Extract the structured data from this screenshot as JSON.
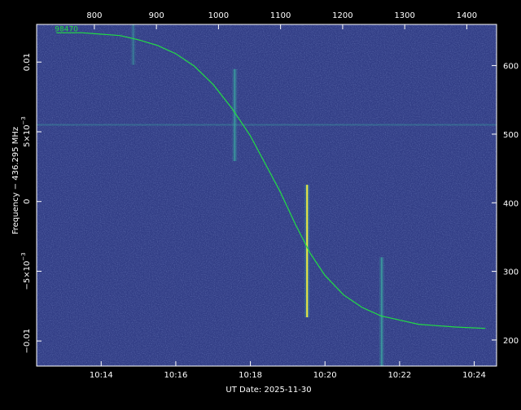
{
  "chart_data": {
    "type": "heatmap",
    "title": "",
    "xlabel": "UT Date: 2025-11-30",
    "ylabel": "Frequency − 436.295 MHz",
    "bottom_axis": {
      "unit": "minutes since 10:00 UT",
      "range": [
        12.27,
        24.6
      ],
      "ticks": [
        {
          "value": 14,
          "label": "10:14"
        },
        {
          "value": 16,
          "label": "10:16"
        },
        {
          "value": 18,
          "label": "10:18"
        },
        {
          "value": 20,
          "label": "10:20"
        },
        {
          "value": 22,
          "label": "10:22"
        },
        {
          "value": 24,
          "label": "10:24"
        }
      ]
    },
    "top_axis": {
      "range": [
        707,
        1448
      ],
      "ticks": [
        {
          "value": 800,
          "label": "800"
        },
        {
          "value": 900,
          "label": "900"
        },
        {
          "value": 1000,
          "label": "1000"
        },
        {
          "value": 1100,
          "label": "1100"
        },
        {
          "value": 1200,
          "label": "1200"
        },
        {
          "value": 1300,
          "label": "1300"
        },
        {
          "value": 1400,
          "label": "1400"
        }
      ]
    },
    "left_axis": {
      "unit": "MHz",
      "range": [
        -0.0118,
        0.0127
      ],
      "ticks": [
        {
          "value": 0.01,
          "label": "0.01",
          "base": "",
          "exp": ""
        },
        {
          "value": 0.005,
          "label": "",
          "base": "5×10",
          "exp": "−3"
        },
        {
          "value": 0,
          "label": "0",
          "base": "",
          "exp": ""
        },
        {
          "value": -0.005,
          "label": "",
          "base": "−5×10",
          "exp": "−3"
        },
        {
          "value": -0.01,
          "label": "−0.01",
          "base": "",
          "exp": ""
        }
      ]
    },
    "right_axis": {
      "range": [
        162,
        660
      ],
      "ticks": [
        {
          "value": 200,
          "label": "200"
        },
        {
          "value": 300,
          "label": "300"
        },
        {
          "value": 400,
          "label": "400"
        },
        {
          "value": 500,
          "label": "500"
        },
        {
          "value": 600,
          "label": "600"
        }
      ]
    },
    "curve": {
      "name": "98470",
      "color": "#22dd44",
      "points": [
        {
          "x": 12.8,
          "y": 0.0121
        },
        {
          "x": 13.5,
          "y": 0.0121
        },
        {
          "x": 14.0,
          "y": 0.012
        },
        {
          "x": 14.5,
          "y": 0.0119
        },
        {
          "x": 15.0,
          "y": 0.0116
        },
        {
          "x": 15.5,
          "y": 0.0112
        },
        {
          "x": 16.0,
          "y": 0.0106
        },
        {
          "x": 16.5,
          "y": 0.0097
        },
        {
          "x": 17.0,
          "y": 0.0084
        },
        {
          "x": 17.5,
          "y": 0.0067
        },
        {
          "x": 18.0,
          "y": 0.0047
        },
        {
          "x": 18.4,
          "y": 0.0027
        },
        {
          "x": 18.8,
          "y": 0.0007
        },
        {
          "x": 19.2,
          "y": -0.0016
        },
        {
          "x": 19.6,
          "y": -0.0037
        },
        {
          "x": 20.0,
          "y": -0.0053
        },
        {
          "x": 20.5,
          "y": -0.0067
        },
        {
          "x": 21.0,
          "y": -0.0076
        },
        {
          "x": 21.5,
          "y": -0.0082
        },
        {
          "x": 22.0,
          "y": -0.0085
        },
        {
          "x": 22.5,
          "y": -0.0088
        },
        {
          "x": 23.0,
          "y": -0.0089
        },
        {
          "x": 23.5,
          "y": -0.009
        },
        {
          "x": 24.3,
          "y": -0.0091
        }
      ]
    },
    "colors": {
      "background": "#000000",
      "plot_background": "#323e86",
      "curve": "#22dd44",
      "signal_bright": "#f0ec40",
      "signal_mid": "#3aa8a0",
      "axes": "#ffffff"
    },
    "features": [
      {
        "kind": "vertical_streak",
        "x": 14.86,
        "y_from": 0.0127,
        "y_to": 0.0098,
        "intensity": "faint"
      },
      {
        "kind": "vertical_streak",
        "x": 17.58,
        "y_from": 0.0095,
        "y_to": 0.0029,
        "intensity": "medium"
      },
      {
        "kind": "vertical_streak",
        "x": 19.52,
        "y_from": 0.0012,
        "y_to": -0.0083,
        "intensity": "bright"
      },
      {
        "kind": "vertical_streak",
        "x": 21.52,
        "y_from": -0.004,
        "y_to": -0.0118,
        "intensity": "medium"
      },
      {
        "kind": "horizontal_band",
        "y": 0.0055,
        "intensity": "faint"
      }
    ],
    "grid": false,
    "legend": "none"
  }
}
